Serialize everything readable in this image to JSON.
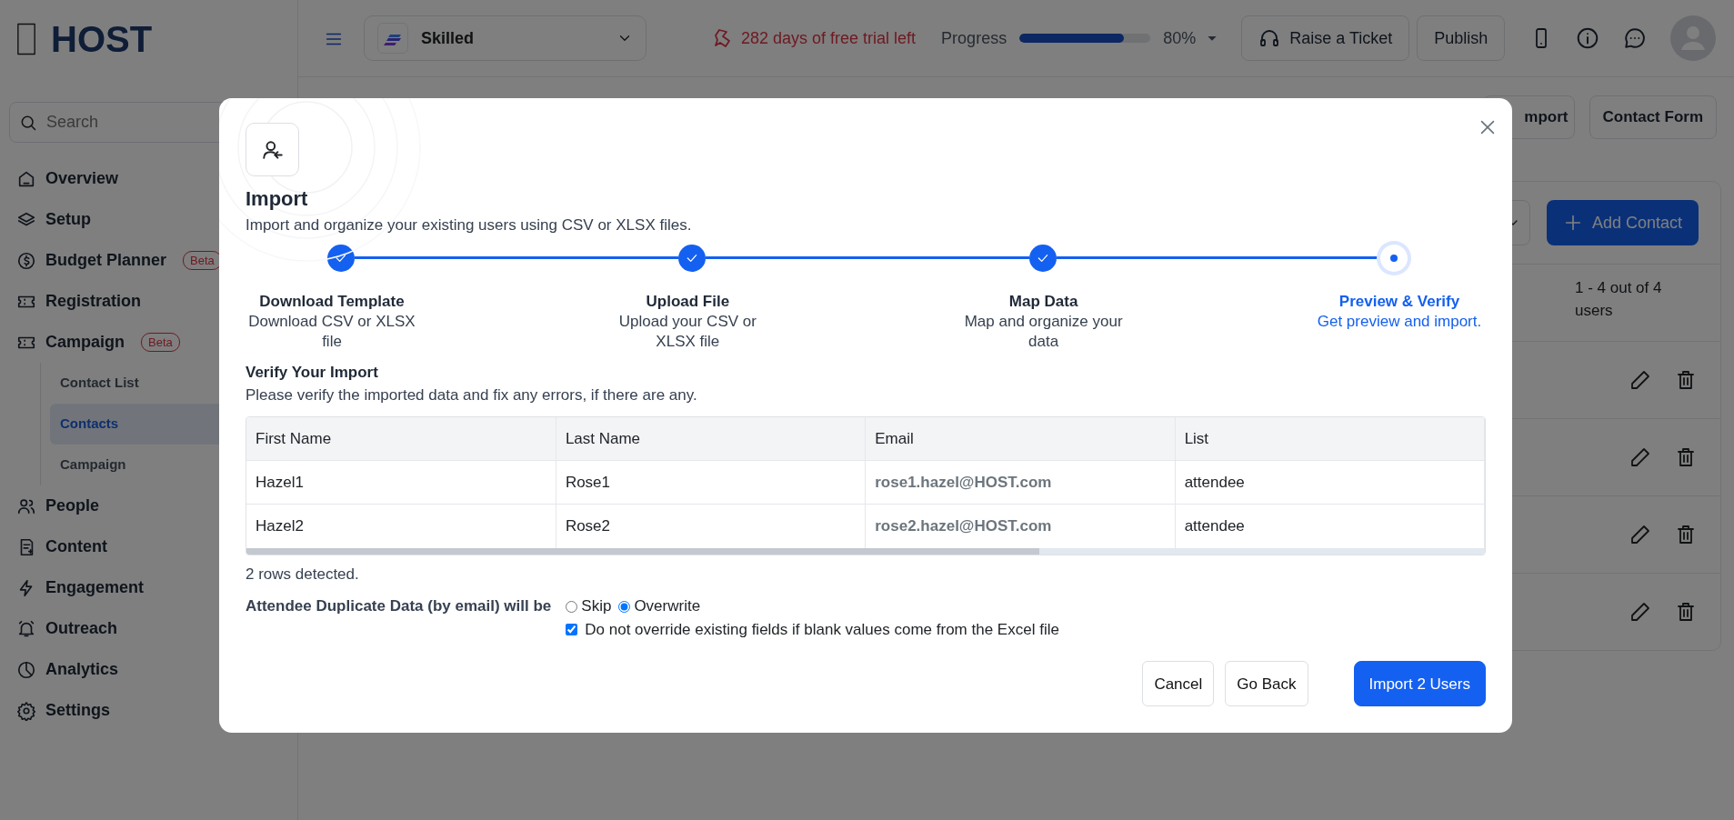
{
  "sidebar": {
    "logo": "HOST",
    "search": {
      "placeholder": "Search"
    },
    "items": [
      {
        "label": "Overview",
        "selected": false
      },
      {
        "label": "Setup",
        "selected": false
      },
      {
        "label": "Budget Planner",
        "badge": "Beta",
        "selected": false
      },
      {
        "label": "Registration",
        "selected": false
      },
      {
        "label": "Campaign",
        "badge": "Beta",
        "selected": false,
        "expanded": true,
        "children": [
          {
            "label": "Contact List",
            "selected": false
          },
          {
            "label": "Contacts",
            "selected": true
          },
          {
            "label": "Campaign",
            "selected": false
          }
        ]
      },
      {
        "label": "People",
        "selected": false
      },
      {
        "label": "Content",
        "selected": false
      },
      {
        "label": "Engagement",
        "selected": false
      },
      {
        "label": "Outreach",
        "selected": false
      },
      {
        "label": "Analytics",
        "selected": false
      },
      {
        "label": "Settings",
        "selected": false
      }
    ]
  },
  "topbar": {
    "workspace": "Skilled",
    "trial": "282 days of free trial left",
    "progress": {
      "label": "Progress",
      "level": 0.8,
      "reading": "80%"
    },
    "buttons": [
      "Raise a Ticket",
      "Publish"
    ]
  },
  "page": {
    "toolbar_buttons": [
      "mport",
      "Contact Form"
    ],
    "add_button": "Add Contact",
    "count": "1 - 4 out of 4 users"
  },
  "modal": {
    "title": "Import",
    "subtitle": "Import and organize your existing users using CSV or XLSX files.",
    "steps": [
      {
        "title": "Download Template",
        "description": "Download CSV or XLSX file",
        "completed": true,
        "selected": false
      },
      {
        "title": "Upload File",
        "description": "Upload your CSV or XLSX file",
        "completed": true,
        "selected": false
      },
      {
        "title": "Map Data",
        "description": "Map and organize your data",
        "completed": true,
        "selected": false
      },
      {
        "title": "Preview & Verify",
        "description": "Get preview and import.",
        "completed": false,
        "selected": true
      }
    ],
    "section_title": "Verify Your Import",
    "section_text": "Please verify the imported data and fix any errors, if there are any.",
    "table": {
      "columns": [
        "First Name",
        "Last Name",
        "Email",
        "List"
      ],
      "rows": [
        [
          "Hazel1",
          "Rose1",
          "rose1.hazel@HOST.com",
          "attendee"
        ],
        [
          "Hazel2",
          "Rose2",
          "rose2.hazel@HOST.com",
          "attendee"
        ]
      ]
    },
    "summary": "2 rows detected.",
    "duplicate": {
      "label": "Attendee Duplicate Data (by email) will be",
      "options": [
        {
          "label": "Skip",
          "selected": false
        },
        {
          "label": "Overwrite",
          "selected": true
        }
      ],
      "keep_blank": {
        "label": "Do not override existing fields if blank values come from the Excel file",
        "checked": true
      }
    },
    "buttons": [
      {
        "label": "Cancel",
        "kind": "secondary"
      },
      {
        "label": "Go Back",
        "kind": "secondary"
      },
      {
        "label": "Import 2 Users",
        "kind": "primary"
      }
    ]
  }
}
